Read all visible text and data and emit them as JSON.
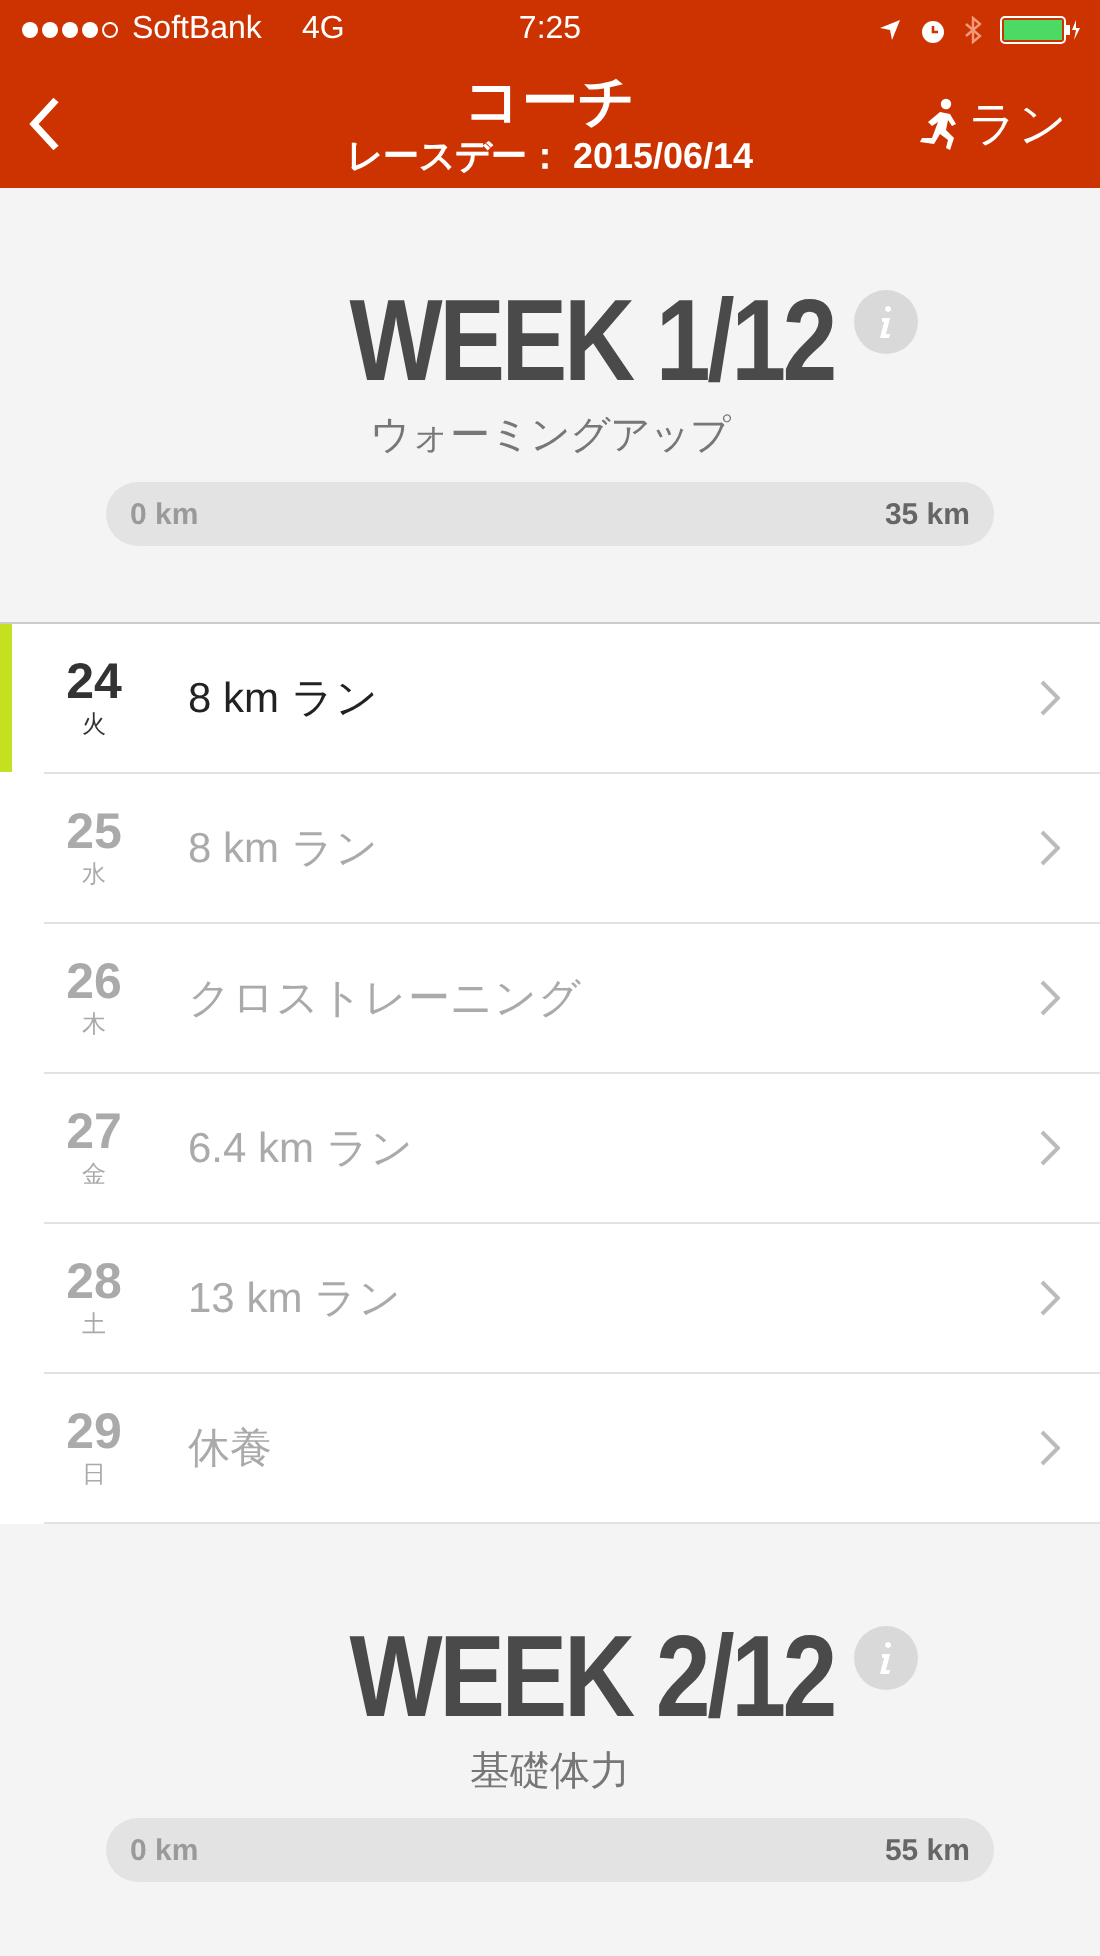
{
  "status_bar": {
    "carrier": "SoftBank",
    "network": "4G",
    "time": "7:25"
  },
  "nav": {
    "title": "コーチ",
    "subtitle": "レースデー： 2015/06/14",
    "action": "ラン"
  },
  "weeks": [
    {
      "title": "WEEK 1/12",
      "phase": "ウォーミングアップ",
      "start": "0 km",
      "end": "35 km",
      "level": 0,
      "days": [
        {
          "date": "24",
          "weekday": "火",
          "workout": "8 km ラン",
          "selected": true
        },
        {
          "date": "25",
          "weekday": "水",
          "workout": "8 km ラン",
          "selected": false
        },
        {
          "date": "26",
          "weekday": "木",
          "workout": "クロストレーニング",
          "selected": false
        },
        {
          "date": "27",
          "weekday": "金",
          "workout": "6.4 km ラン",
          "selected": false
        },
        {
          "date": "28",
          "weekday": "土",
          "workout": "13 km ラン",
          "selected": false
        },
        {
          "date": "29",
          "weekday": "日",
          "workout": "休養",
          "selected": false
        }
      ]
    },
    {
      "title": "WEEK 2/12",
      "phase": "基礎体力",
      "start": "0 km",
      "end": "55 km",
      "level": 0
    }
  ]
}
